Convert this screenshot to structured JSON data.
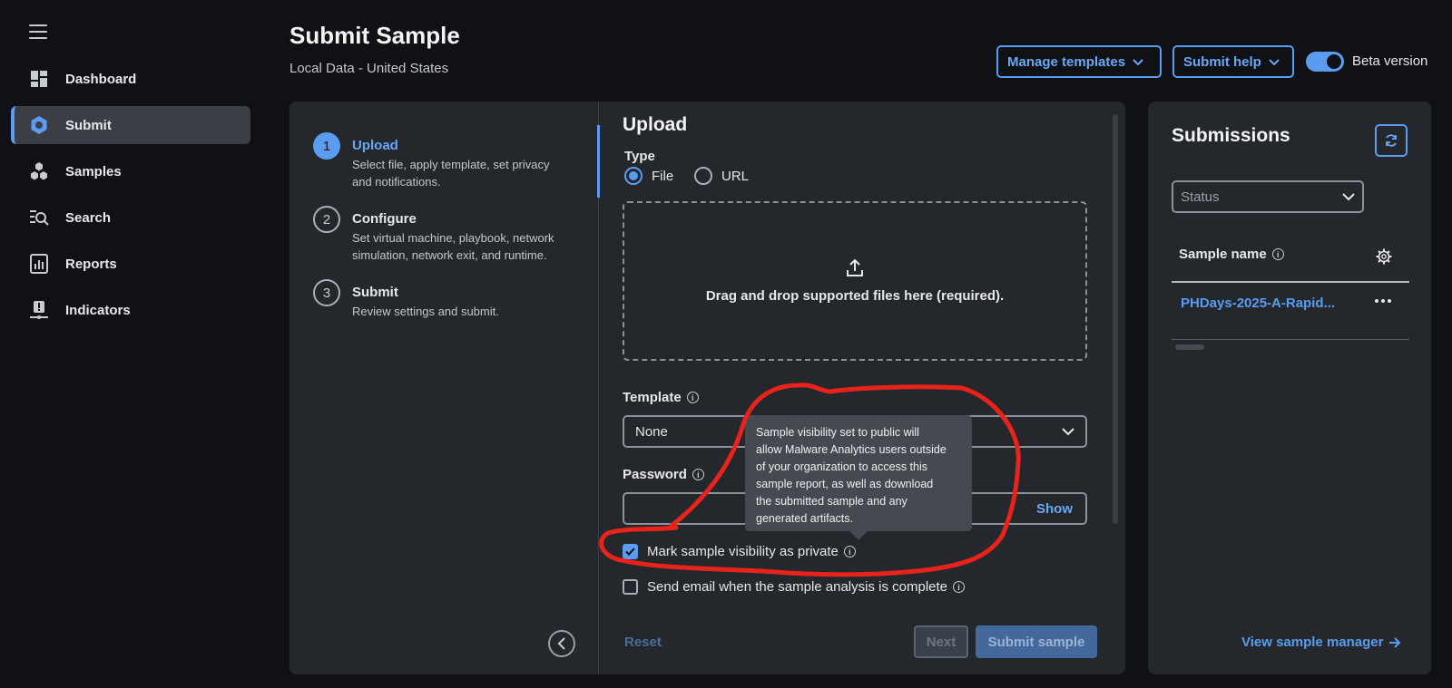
{
  "sidebar": {
    "items": [
      {
        "label": "Dashboard",
        "icon": "dashboard-icon",
        "active": false
      },
      {
        "label": "Submit",
        "icon": "submit-gear-icon",
        "active": true
      },
      {
        "label": "Samples",
        "icon": "samples-cubes-icon",
        "active": false
      },
      {
        "label": "Search",
        "icon": "search-icon",
        "active": false
      },
      {
        "label": "Reports",
        "icon": "reports-icon",
        "active": false
      },
      {
        "label": "Indicators",
        "icon": "indicators-icon",
        "active": false
      }
    ]
  },
  "header": {
    "title": "Submit Sample",
    "subtitle": "Local Data - United States",
    "manage_templates": "Manage templates",
    "submit_help": "Submit help",
    "beta_label": "Beta version",
    "beta_enabled": true
  },
  "steps": [
    {
      "num": "1",
      "title": "Upload",
      "desc": "Select file, apply template, set privacy and notifications."
    },
    {
      "num": "2",
      "title": "Configure",
      "desc": "Set virtual machine, playbook, network simulation, network exit, and runtime."
    },
    {
      "num": "3",
      "title": "Submit",
      "desc": "Review settings and submit."
    }
  ],
  "form": {
    "title": "Upload",
    "type_label": "Type",
    "type_options": [
      "File",
      "URL"
    ],
    "type_selected": "File",
    "dropzone_text": "Drag and drop supported files here (required).",
    "template_label": "Template",
    "template_value": "None",
    "password_label": "Password",
    "password_show": "Show",
    "private_label": "Mark sample visibility as private",
    "private_checked": true,
    "email_label": "Send email when the sample analysis is complete",
    "email_checked": false,
    "tooltip_lines": [
      "Sample visibility set to public will",
      "allow Malware Analytics users outside",
      "of your organization to access this",
      "sample report, as well as download",
      "the submitted sample and any",
      "generated artifacts."
    ],
    "reset": "Reset",
    "next": "Next",
    "submit": "Submit sample"
  },
  "submissions": {
    "title": "Submissions",
    "status_placeholder": "Status",
    "col_header": "Sample name",
    "rows": [
      {
        "name": "PHDays-2025-A-Rapid..."
      }
    ],
    "view_manager": "View sample manager"
  },
  "colors": {
    "accent": "#5a9cf0",
    "annotation": "#e8231b"
  }
}
